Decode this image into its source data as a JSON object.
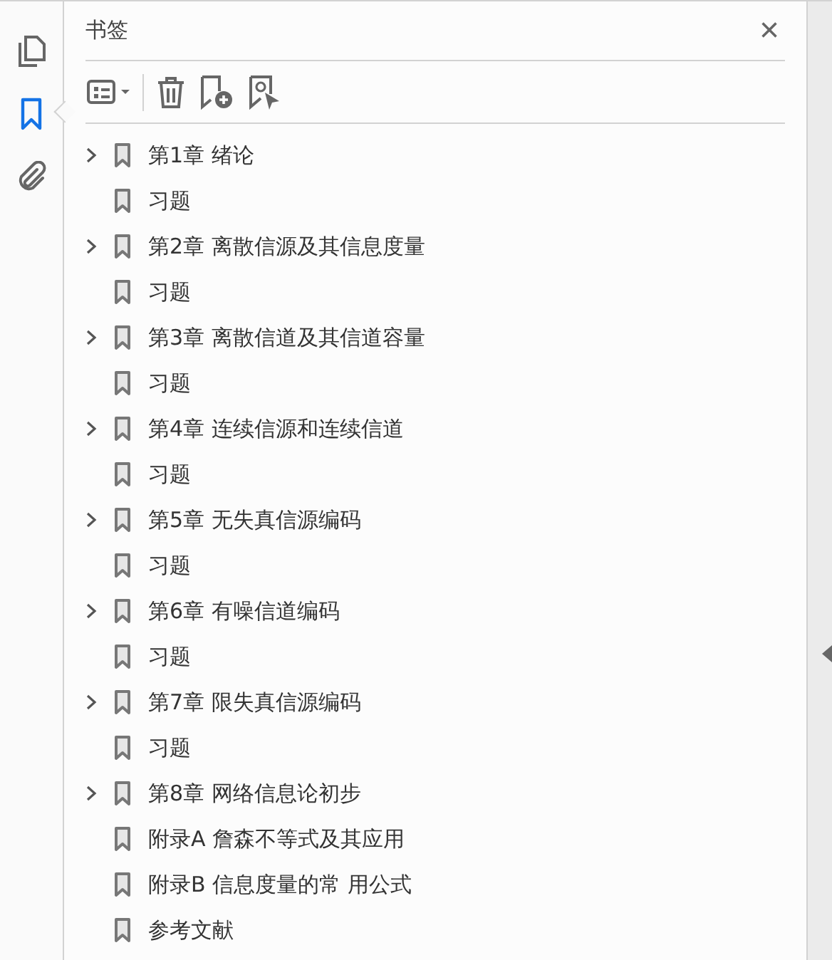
{
  "rail": [
    {
      "kind": "pages",
      "selected": false
    },
    {
      "kind": "bookmarks",
      "selected": true
    },
    {
      "kind": "attachments",
      "selected": false
    }
  ],
  "panel": {
    "title": "书签",
    "close": "×"
  },
  "bookmarks": [
    {
      "label": "第1章 绪论",
      "kind": "parent",
      "expanded": false
    },
    {
      "label": "习题",
      "kind": "leaf"
    },
    {
      "label": "第2章 离散信源及其信息度量",
      "kind": "parent",
      "expanded": false
    },
    {
      "label": "习题",
      "kind": "leaf"
    },
    {
      "label": "第3章 离散信道及其信道容量",
      "kind": "parent",
      "expanded": false
    },
    {
      "label": "习题",
      "kind": "leaf"
    },
    {
      "label": "第4章 连续信源和连续信道",
      "kind": "parent",
      "expanded": false
    },
    {
      "label": "习题",
      "kind": "leaf"
    },
    {
      "label": "第5章 无失真信源编码",
      "kind": "parent",
      "expanded": false
    },
    {
      "label": "习题",
      "kind": "leaf"
    },
    {
      "label": "第6章 有噪信道编码",
      "kind": "parent",
      "expanded": false
    },
    {
      "label": "习题",
      "kind": "leaf"
    },
    {
      "label": "第7章 限失真信源编码",
      "kind": "parent",
      "expanded": false
    },
    {
      "label": "习题",
      "kind": "leaf"
    },
    {
      "label": "第8章 网络信息论初步",
      "kind": "parent",
      "expanded": false
    },
    {
      "label": "附录A 詹森不等式及其应用",
      "kind": "leaf"
    },
    {
      "label": "附录B 信息度量的常 用公式",
      "kind": "leaf"
    },
    {
      "label": "参考文献",
      "kind": "leaf"
    }
  ]
}
